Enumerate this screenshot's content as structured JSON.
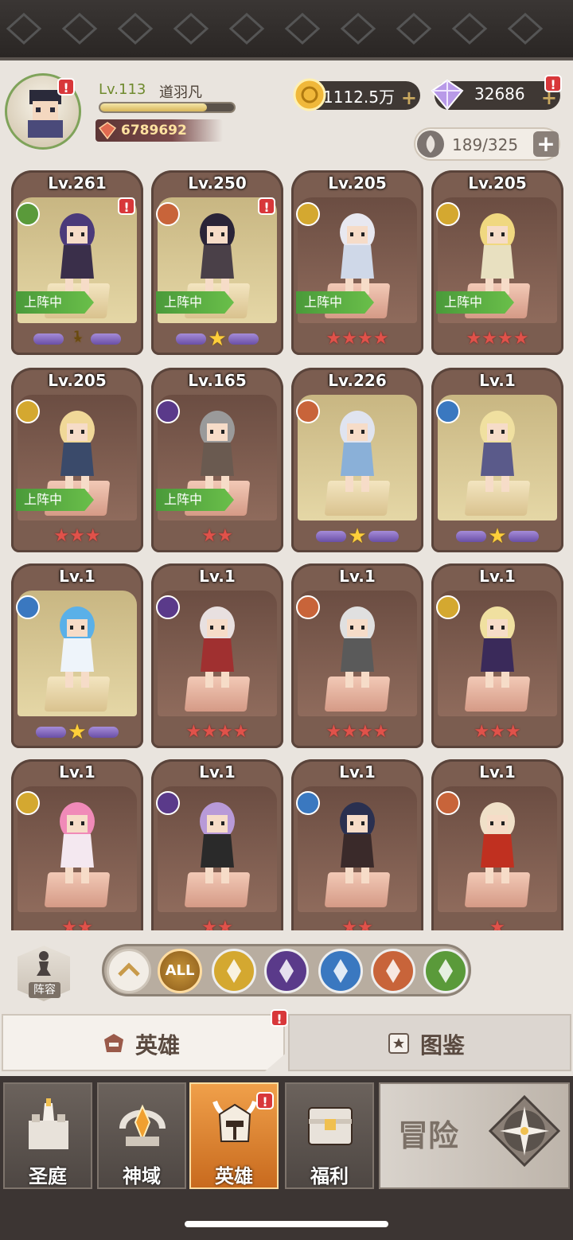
{
  "player": {
    "level": "Lv.113",
    "name": "道羽凡",
    "xp_fraction": 0.8,
    "power": "6789692"
  },
  "currency": {
    "gold": "1112.5万",
    "gems": "32686",
    "capacity": "189/325"
  },
  "heroes": [
    {
      "level": "Lv.261",
      "faction": "nature",
      "deployed": "上阵中",
      "stars": "purple-1",
      "star_label": "1",
      "alert": true,
      "bg": "gold",
      "hair": "#4b3a7a",
      "outfit": "#3a2f4a"
    },
    {
      "level": "Lv.250",
      "faction": "beast",
      "deployed": "上阵中",
      "stars": "purple-gold",
      "alert": true,
      "bg": "gold",
      "hair": "#2a2438",
      "outfit": "#4a4048"
    },
    {
      "level": "Lv.205",
      "faction": "light",
      "deployed": "上阵中",
      "stars": "red-4",
      "alert": false,
      "bg": "brown",
      "hair": "#e8e8f0",
      "outfit": "#cfd8e8"
    },
    {
      "level": "Lv.205",
      "faction": "light",
      "deployed": "上阵中",
      "stars": "red-4",
      "alert": false,
      "bg": "brown",
      "hair": "#f0d880",
      "outfit": "#e8e0c0"
    },
    {
      "level": "Lv.205",
      "faction": "light",
      "deployed": "上阵中",
      "stars": "red-3",
      "alert": false,
      "bg": "brown",
      "hair": "#f0d898",
      "outfit": "#3a4a6a"
    },
    {
      "level": "Lv.165",
      "faction": "dark",
      "deployed": "上阵中",
      "stars": "red-2",
      "alert": false,
      "bg": "brown",
      "hair": "#9a9a9a",
      "outfit": "#6a5a50"
    },
    {
      "level": "Lv.226",
      "faction": "beast",
      "deployed": "",
      "stars": "purple-gold",
      "alert": false,
      "bg": "gold",
      "hair": "#e0e4f0",
      "outfit": "#8ab0d8"
    },
    {
      "level": "Lv.1",
      "faction": "holy",
      "deployed": "",
      "stars": "purple-gold",
      "alert": false,
      "bg": "gold",
      "hair": "#f0e0a0",
      "outfit": "#5a5a8a"
    },
    {
      "level": "Lv.1",
      "faction": "holy",
      "deployed": "",
      "stars": "purple-gold",
      "alert": false,
      "bg": "gold",
      "hair": "#5ab0e8",
      "outfit": "#eef4fa"
    },
    {
      "level": "Lv.1",
      "faction": "dark",
      "deployed": "",
      "stars": "red-4",
      "alert": false,
      "bg": "brown",
      "hair": "#e8e0e0",
      "outfit": "#a03030"
    },
    {
      "level": "Lv.1",
      "faction": "beast",
      "deployed": "",
      "stars": "red-4",
      "alert": false,
      "bg": "brown",
      "hair": "#e0e0e0",
      "outfit": "#5a5a5a"
    },
    {
      "level": "Lv.1",
      "faction": "light",
      "deployed": "",
      "stars": "red-3",
      "alert": false,
      "bg": "brown",
      "hair": "#f0e0a0",
      "outfit": "#3a2a5a"
    },
    {
      "level": "Lv.1",
      "faction": "light",
      "deployed": "",
      "stars": "red-2",
      "alert": false,
      "bg": "brown",
      "hair": "#f08ab8",
      "outfit": "#f4e8f0"
    },
    {
      "level": "Lv.1",
      "faction": "dark",
      "deployed": "",
      "stars": "red-2",
      "alert": false,
      "bg": "brown",
      "hair": "#b89ad8",
      "outfit": "#2a2a2a"
    },
    {
      "level": "Lv.1",
      "faction": "holy",
      "deployed": "",
      "stars": "red-2",
      "alert": false,
      "bg": "brown",
      "hair": "#2a3050",
      "outfit": "#3a2a2a"
    },
    {
      "level": "Lv.1",
      "faction": "beast",
      "deployed": "",
      "stars": "red-1",
      "alert": false,
      "bg": "brown",
      "hair": "#f0e0c8",
      "outfit": "#c03020"
    }
  ],
  "faction_colors": {
    "nature": "#5a9a3a",
    "beast": "#c8643a",
    "light": "#d4a830",
    "dark": "#5a3a8a",
    "holy": "#3a78c0"
  },
  "filters": [
    {
      "key": "collapse",
      "label": ""
    },
    {
      "key": "all",
      "label": "ALL"
    },
    {
      "key": "light",
      "label": ""
    },
    {
      "key": "dark",
      "label": ""
    },
    {
      "key": "holy",
      "label": ""
    },
    {
      "key": "beast",
      "label": ""
    },
    {
      "key": "nature",
      "label": ""
    }
  ],
  "roster_label": "阵容",
  "tabs": {
    "heroes": "英雄",
    "codex": "图鉴"
  },
  "nav": {
    "sanctum": "圣庭",
    "divine": "神域",
    "heroes": "英雄",
    "welfare": "福利",
    "adventure": "冒险"
  }
}
